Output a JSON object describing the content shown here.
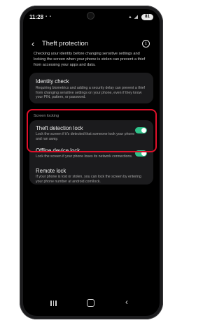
{
  "status": {
    "time": "11:28",
    "battery": "81"
  },
  "header": {
    "title": "Theft protection"
  },
  "intro_text": "Checking your identity before changing sensitive settings and locking the screen when your phone is stolen can prevent a thief from accessing your apps and data.",
  "identity_check": {
    "title": "Identity check",
    "description": "Requiring biometrics and adding a security delay can prevent a thief from changing sensitive settings on your phone, even if they know your PIN, pattern, or password."
  },
  "screen_locking": {
    "section_label": "Screen locking",
    "items": [
      {
        "title": "Theft detection lock",
        "description": "Lock the screen if it's detected that someone took your phone and ran away.",
        "enabled": true
      },
      {
        "title": "Offline device lock",
        "description": "Lock the screen if your phone loses its network connections.",
        "enabled": true
      },
      {
        "title": "Remote lock",
        "description": "If your phone is lost or stolen, you can lock the screen by entering your phone number at android.com/lock."
      }
    ]
  },
  "colors": {
    "toggle_on": "#2fc38a",
    "highlight_border": "#e0102a",
    "card_background": "#1b1b1d"
  }
}
